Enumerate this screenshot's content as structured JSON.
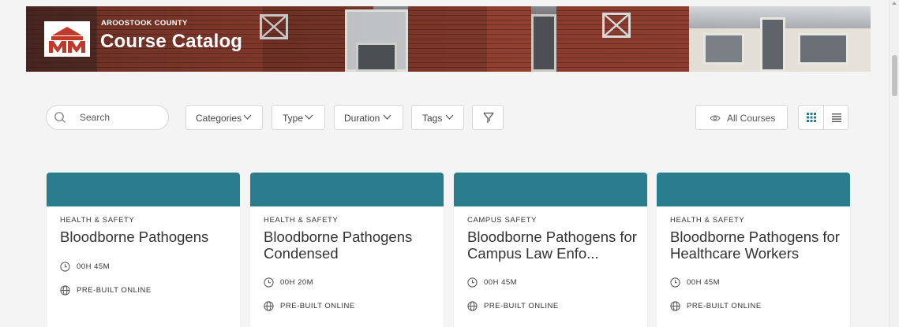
{
  "header": {
    "org_name": "AROOSTOOK COUNTY",
    "title": "Course Catalog",
    "logo_icon": "mm-logo-icon",
    "logo_color": "#c0392b"
  },
  "toolbar": {
    "search_placeholder": "Search",
    "filters": [
      {
        "label": "Categories"
      },
      {
        "label": "Type"
      },
      {
        "label": "Duration"
      },
      {
        "label": "Tags"
      }
    ],
    "filter_icon": "funnel-icon",
    "visibility_label": "All Courses",
    "visibility_icon": "eye-icon",
    "view_modes": [
      "grid-view-icon",
      "list-view-icon"
    ],
    "active_view": "grid",
    "accent_color": "#2a7d8c"
  },
  "courses": [
    {
      "category": "HEALTH & SAFETY",
      "title": "Bloodborne Pathogens",
      "duration": "00H 45M",
      "format": "PRE-BUILT ONLINE"
    },
    {
      "category": "HEALTH & SAFETY",
      "title": "Bloodborne Pathogens Condensed",
      "duration": "00H 20M",
      "format": "PRE-BUILT ONLINE"
    },
    {
      "category": "CAMPUS SAFETY",
      "title": "Bloodborne Pathogens for Campus Law Enfo...",
      "duration": "00H 45M",
      "format": "PRE-BUILT ONLINE"
    },
    {
      "category": "HEALTH & SAFETY",
      "title": "Bloodborne Pathogens for Healthcare Workers",
      "duration": "00H 45M",
      "format": "PRE-BUILT ONLINE"
    }
  ],
  "card_band_color": "#2a7d8c"
}
